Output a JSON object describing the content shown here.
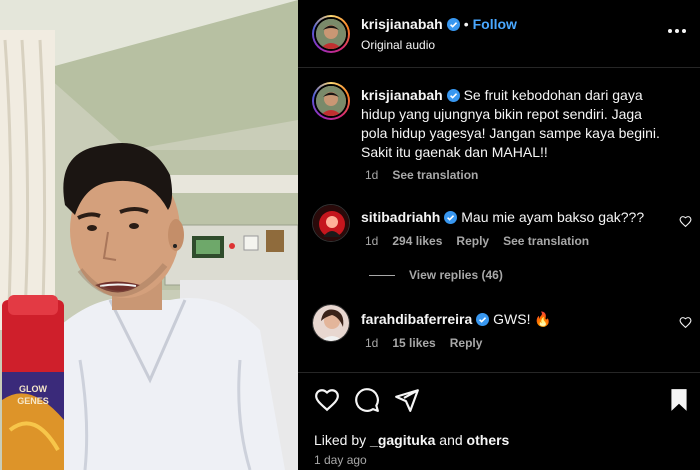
{
  "post": {
    "author": "krisjianabah",
    "follow_label": "Follow",
    "dot": "•",
    "audio": "Original audio",
    "more_icon": "more-horizontal-icon"
  },
  "caption": {
    "username": "krisjianabah",
    "text": "Se fruit kebodohan dari gaya hidup yang ujungnya bikin repot sendiri. Jaga pola hidup yagesya! Jangan sampe kaya begini. Sakit itu gaenak dan MAHAL!!",
    "time": "1d",
    "translation": "See translation"
  },
  "comments": [
    {
      "username": "sitibadriahh",
      "text": "Mau mie ayam bakso gak???",
      "time": "1d",
      "likes": "294 likes",
      "reply": "Reply",
      "translation": "See translation",
      "view_replies": "View replies (46)"
    },
    {
      "username": "farahdibaferreira",
      "text": "GWS! 🔥",
      "time": "1d",
      "likes": "15 likes",
      "reply": "Reply"
    }
  ],
  "footer": {
    "liked_by_prefix": "Liked by",
    "liked_by_user": "_gagituka",
    "liked_by_and": "and",
    "liked_by_others": "others",
    "time": "1 day ago"
  },
  "media": {
    "product_label_top": "GLOW",
    "product_label_bottom": "GENES"
  },
  "colors": {
    "accent": "#4aa8ff",
    "verified": "#3897f0",
    "background": "#000000",
    "muted": "#a8a8a8"
  }
}
